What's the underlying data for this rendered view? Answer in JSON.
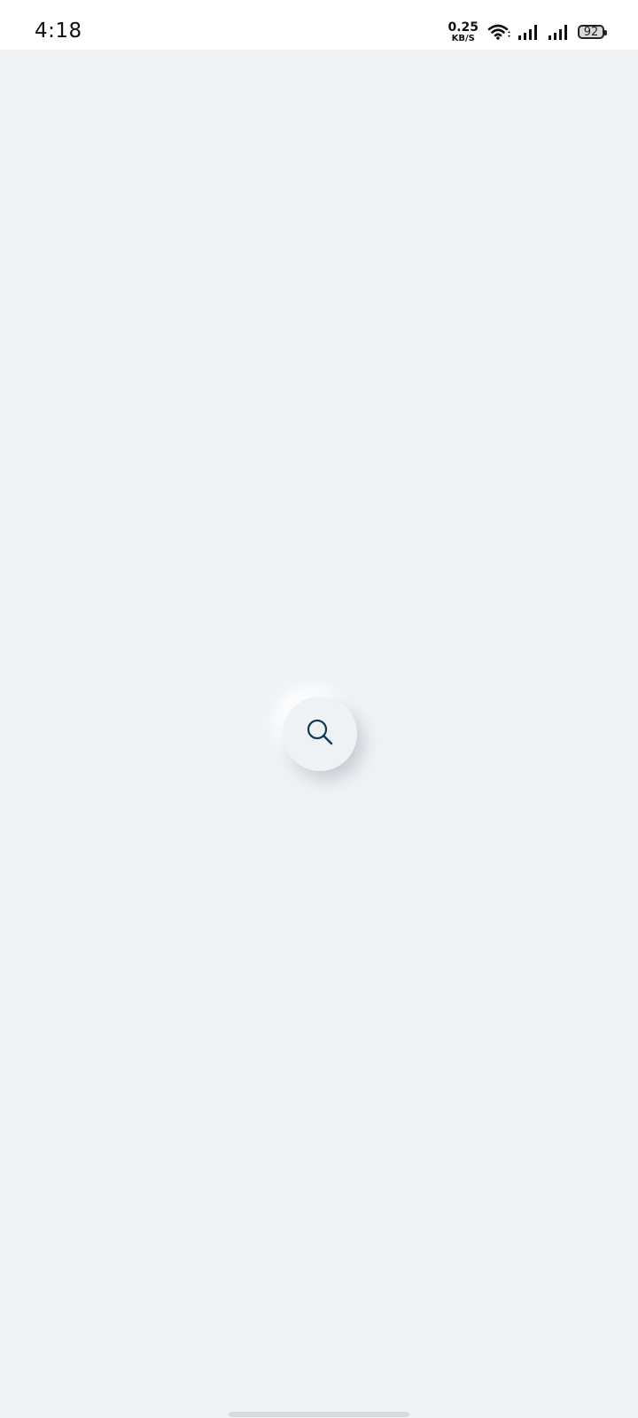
{
  "status_bar": {
    "time": "4:18",
    "net_speed_value": "0.25",
    "net_speed_unit": "KB/S",
    "battery_level": "92",
    "icons": [
      "wifi-icon",
      "signal-icon",
      "signal-icon",
      "battery-icon"
    ]
  },
  "main": {
    "search_button_icon": "search-icon"
  },
  "colors": {
    "background": "#eff3f6",
    "status_bar_bg": "#ffffff",
    "icon_stroke": "#0f3a52"
  }
}
